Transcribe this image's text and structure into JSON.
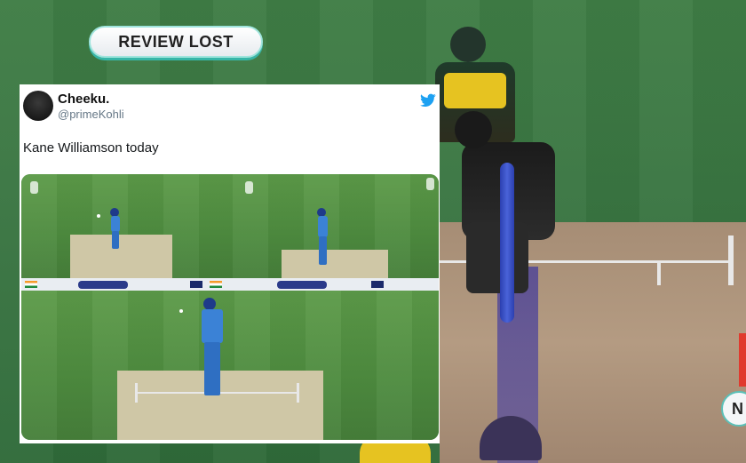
{
  "review_badge": {
    "label": "REVIEW LOST"
  },
  "right_edge_tag": {
    "text": "N"
  },
  "tweet": {
    "display_name": "Cheeku.",
    "handle": "@primeKohli",
    "text": "Kane Williamson today",
    "icon": "twitter-bird-icon",
    "avatar": "profile-avatar"
  },
  "colors": {
    "twitter_blue": "#1da1f2",
    "review_accent": "#37b6a8",
    "hawkeye_stump": "#3a55cc"
  }
}
